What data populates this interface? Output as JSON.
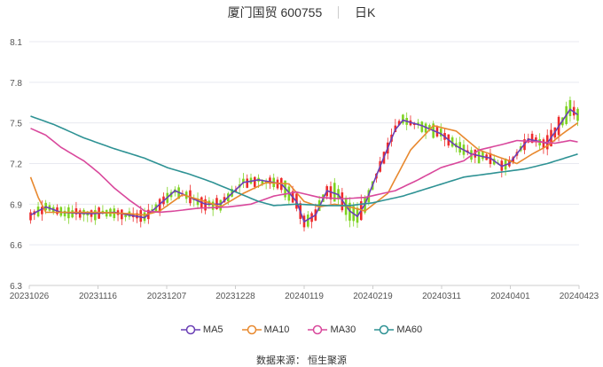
{
  "header": {
    "title": "厦门国贸 600755",
    "period": "日K"
  },
  "source": {
    "label": "数据来源：",
    "name": "恒生聚源"
  },
  "colors": {
    "up": "#ee2b2b",
    "down": "#7ed321",
    "grid": "#e8eaf0",
    "axis": "#555555"
  },
  "chart_data": {
    "type": "candlestick",
    "title": "厦门国贸 600755",
    "y_ticks": [
      "6.3",
      "6.6",
      "6.9",
      "7.2",
      "7.5",
      "7.8",
      "8.1"
    ],
    "ylim": [
      6.3,
      8.1
    ],
    "x_tick_labels": [
      "20231026",
      "20231116",
      "20231207",
      "20231228",
      "20240119",
      "20240219",
      "20240311",
      "20240401",
      "20240423"
    ],
    "grid": true,
    "legend_position": "bottom",
    "series": [
      {
        "name": "MA5",
        "color": "#6a3fb5",
        "knots": [
          [
            0,
            6.82
          ],
          [
            4,
            6.88
          ],
          [
            8,
            6.84
          ],
          [
            16,
            6.83
          ],
          [
            22,
            6.84
          ],
          [
            26,
            6.82
          ],
          [
            30,
            6.8
          ],
          [
            34,
            6.9
          ],
          [
            38,
            7.0
          ],
          [
            42,
            6.95
          ],
          [
            46,
            6.9
          ],
          [
            50,
            6.9
          ],
          [
            56,
            7.06
          ],
          [
            60,
            7.08
          ],
          [
            66,
            7.05
          ],
          [
            70,
            6.92
          ],
          [
            72,
            6.77
          ],
          [
            75,
            6.82
          ],
          [
            78,
            7.0
          ],
          [
            81,
            6.97
          ],
          [
            84,
            6.85
          ],
          [
            86,
            6.81
          ],
          [
            88,
            6.9
          ],
          [
            92,
            7.18
          ],
          [
            96,
            7.45
          ],
          [
            98,
            7.52
          ],
          [
            103,
            7.48
          ],
          [
            108,
            7.42
          ],
          [
            112,
            7.33
          ],
          [
            116,
            7.27
          ],
          [
            121,
            7.24
          ],
          [
            124,
            7.18
          ],
          [
            126,
            7.2
          ],
          [
            131,
            7.38
          ],
          [
            136,
            7.35
          ],
          [
            142,
            7.6
          ],
          [
            144,
            7.56
          ]
        ]
      },
      {
        "name": "MA10",
        "color": "#e8892f",
        "knots": [
          [
            0,
            7.1
          ],
          [
            2,
            6.95
          ],
          [
            4,
            6.84
          ],
          [
            10,
            6.84
          ],
          [
            18,
            6.84
          ],
          [
            26,
            6.83
          ],
          [
            30,
            6.82
          ],
          [
            34,
            6.85
          ],
          [
            40,
            6.97
          ],
          [
            46,
            6.92
          ],
          [
            50,
            6.88
          ],
          [
            56,
            6.98
          ],
          [
            62,
            7.06
          ],
          [
            68,
            7.05
          ],
          [
            72,
            6.92
          ],
          [
            76,
            6.88
          ],
          [
            80,
            6.9
          ],
          [
            84,
            6.88
          ],
          [
            88,
            6.85
          ],
          [
            94,
            6.98
          ],
          [
            100,
            7.3
          ],
          [
            106,
            7.48
          ],
          [
            112,
            7.44
          ],
          [
            118,
            7.3
          ],
          [
            124,
            7.24
          ],
          [
            128,
            7.2
          ],
          [
            132,
            7.27
          ],
          [
            136,
            7.33
          ],
          [
            140,
            7.42
          ],
          [
            144,
            7.5
          ]
        ]
      },
      {
        "name": "MA30",
        "color": "#d9489c",
        "knots": [
          [
            0,
            7.46
          ],
          [
            4,
            7.41
          ],
          [
            8,
            7.32
          ],
          [
            14,
            7.22
          ],
          [
            18,
            7.13
          ],
          [
            22,
            7.02
          ],
          [
            26,
            6.93
          ],
          [
            30,
            6.85
          ],
          [
            34,
            6.84
          ],
          [
            38,
            6.85
          ],
          [
            44,
            6.87
          ],
          [
            52,
            6.88
          ],
          [
            58,
            6.9
          ],
          [
            64,
            6.96
          ],
          [
            70,
            6.99
          ],
          [
            76,
            6.95
          ],
          [
            82,
            6.94
          ],
          [
            88,
            6.95
          ],
          [
            96,
            7.0
          ],
          [
            102,
            7.08
          ],
          [
            108,
            7.17
          ],
          [
            114,
            7.22
          ],
          [
            118,
            7.3
          ],
          [
            124,
            7.34
          ],
          [
            128,
            7.37
          ],
          [
            134,
            7.36
          ],
          [
            138,
            7.35
          ],
          [
            142,
            7.37
          ],
          [
            144,
            7.36
          ]
        ]
      },
      {
        "name": "MA60",
        "color": "#2e9294",
        "knots": [
          [
            0,
            7.55
          ],
          [
            6,
            7.49
          ],
          [
            14,
            7.39
          ],
          [
            22,
            7.31
          ],
          [
            30,
            7.24
          ],
          [
            36,
            7.17
          ],
          [
            42,
            7.12
          ],
          [
            48,
            7.06
          ],
          [
            54,
            6.99
          ],
          [
            60,
            6.92
          ],
          [
            64,
            6.89
          ],
          [
            70,
            6.9
          ],
          [
            78,
            6.89
          ],
          [
            84,
            6.89
          ],
          [
            90,
            6.91
          ],
          [
            98,
            6.96
          ],
          [
            106,
            7.03
          ],
          [
            114,
            7.1
          ],
          [
            122,
            7.13
          ],
          [
            130,
            7.16
          ],
          [
            136,
            7.2
          ],
          [
            144,
            7.27
          ]
        ]
      }
    ]
  }
}
